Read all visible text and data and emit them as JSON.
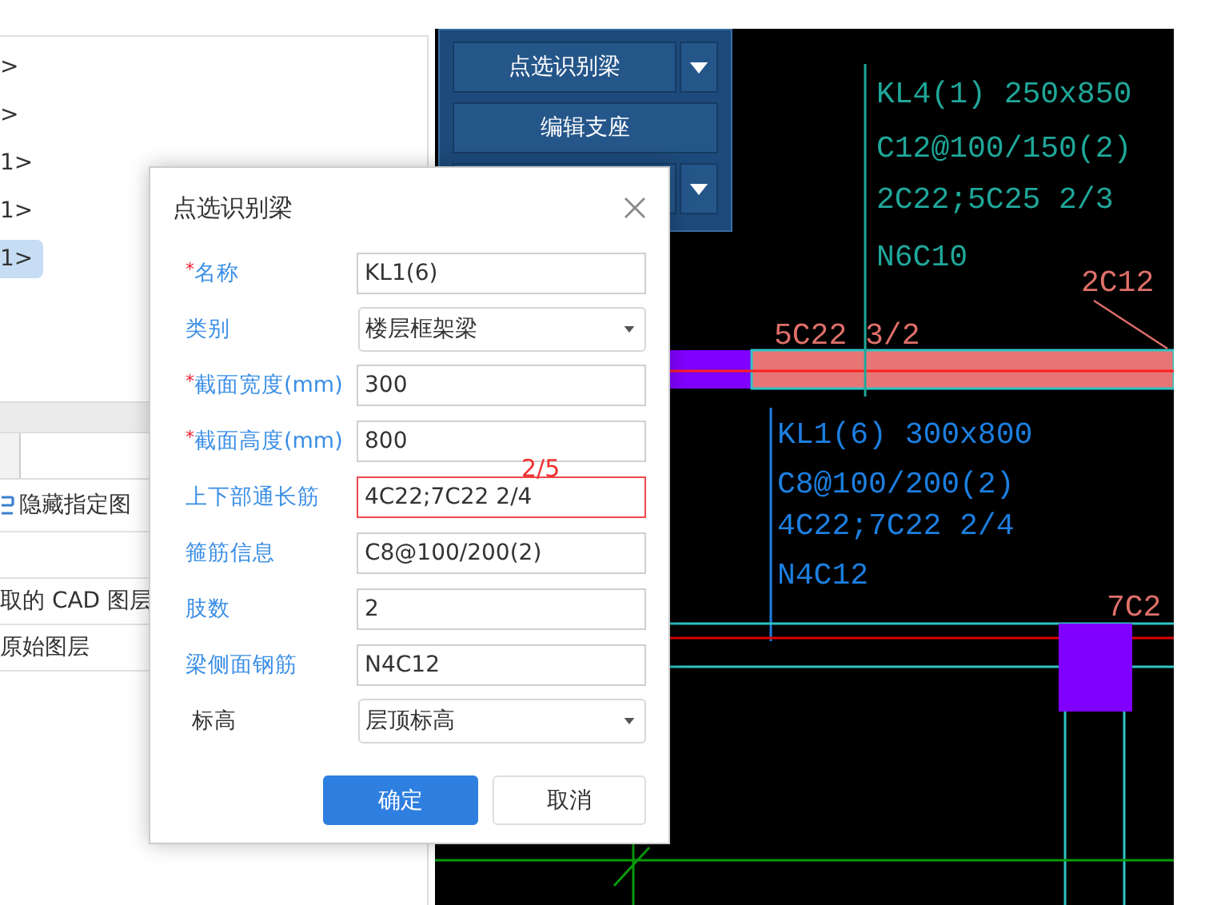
{
  "left_panel": {
    "tree_items": [
      {
        "label": ">",
        "selected": false
      },
      {
        "label": ">",
        "selected": false
      },
      {
        "label": "1>",
        "selected": false
      },
      {
        "label": "1>",
        "selected": false
      },
      {
        "label": "1>",
        "selected": true
      }
    ],
    "layer_rows": [
      {
        "kind": "icon",
        "label": "隐藏指定图"
      },
      {
        "kind": "blank"
      },
      {
        "kind": "text",
        "label": "取的 CAD 图层"
      },
      {
        "kind": "text",
        "label": "原始图层"
      }
    ]
  },
  "toolbar": {
    "buttons": [
      {
        "label": "点选识别梁",
        "dropdown": true
      },
      {
        "label": "编辑支座",
        "dropdown": false
      },
      {
        "dropdown": true
      }
    ]
  },
  "canvas": {
    "annotations": [
      {
        "text": "KL4(1) 250x850",
        "color": "#1fa79a"
      },
      {
        "text": "C12@100/150(2)",
        "color": "#1fa79a"
      },
      {
        "text": "2C22;5C25 2/3",
        "color": "#1fa79a"
      },
      {
        "text": "N6C10",
        "color": "#1fa79a"
      },
      {
        "text": "2C12",
        "color": "#e0706a"
      },
      {
        "text": "5C22 3/2",
        "color": "#e0706a"
      },
      {
        "text": "KL1(6) 300x800",
        "color": "#1c7fe0"
      },
      {
        "text": "C8@100/200(2)",
        "color": "#1c7fe0"
      },
      {
        "text": "4C22;7C22 2/4",
        "color": "#1c7fe0"
      },
      {
        "text": "N4C12",
        "color": "#1c7fe0"
      },
      {
        "text": "7C2",
        "color": "#e0706a"
      }
    ]
  },
  "dialog": {
    "title": "点选识别梁",
    "fields": [
      {
        "label": "名称",
        "marker": "*",
        "emphasis": true,
        "kind": "text",
        "value": "KL1(6)",
        "error": false
      },
      {
        "label": "类别",
        "emphasis": true,
        "kind": "select",
        "value": "楼层框架梁",
        "error": false
      },
      {
        "label": "截面宽度(mm)",
        "marker": "*",
        "emphasis": true,
        "kind": "text",
        "value": "300",
        "error": false
      },
      {
        "label": "截面高度(mm)",
        "marker": "*",
        "emphasis": true,
        "kind": "text",
        "value": "800",
        "error": false
      },
      {
        "label": "上下部通长筋",
        "emphasis": true,
        "kind": "text",
        "value": "4C22;7C22 2/4",
        "error": true,
        "note": "2/5"
      },
      {
        "label": "箍筋信息",
        "emphasis": true,
        "kind": "text",
        "value": "C8@100/200(2)",
        "error": false
      },
      {
        "label": "肢数",
        "emphasis": true,
        "kind": "text",
        "value": "2",
        "error": false
      },
      {
        "label": "梁侧面钢筋",
        "emphasis": true,
        "kind": "text",
        "value": "N4C12",
        "error": false
      },
      {
        "label": "标高",
        "emphasis": false,
        "kind": "select",
        "value": "层顶标高",
        "error": false
      }
    ],
    "buttons": [
      {
        "label": "确定",
        "primary": true
      },
      {
        "label": "取消",
        "primary": false
      }
    ]
  }
}
